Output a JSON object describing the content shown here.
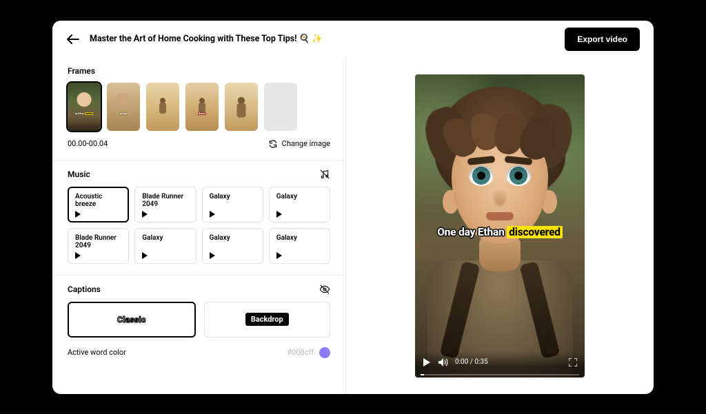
{
  "header": {
    "title": "Master the Art of Home Cooking with These Top Tips! ",
    "emoji1": "🍳",
    "emoji2": "✨",
    "export_label": "Export video"
  },
  "frames": {
    "section_label": "Frames",
    "timecode": "00.00-00.04",
    "change_label": "Change image",
    "caption1_a": "ay Ethan",
    "caption1_b": "iscove",
    "caption2": "an eye",
    "caption4": "desert"
  },
  "music": {
    "section_label": "Music",
    "tracks": [
      {
        "name": "Acoustic breeze",
        "selected": true
      },
      {
        "name": "Blade Runner 2049",
        "selected": false
      },
      {
        "name": "Galaxy",
        "selected": false
      },
      {
        "name": "Galaxy",
        "selected": false
      },
      {
        "name": "Blade Runner 2049",
        "selected": false
      },
      {
        "name": "Galaxy",
        "selected": false
      },
      {
        "name": "Galaxy",
        "selected": false
      },
      {
        "name": "Galaxy",
        "selected": false
      }
    ]
  },
  "captions": {
    "section_label": "Captions",
    "style_classic": "Classic",
    "style_backdrop": "Backdrop",
    "active_label": "Active word color",
    "hex": "#008cff",
    "swatch_color": "#8d7bff"
  },
  "preview": {
    "caption_plain": "One day Ethan ",
    "caption_highlight": "discovered",
    "time_display": "0:00 / 0:35"
  }
}
